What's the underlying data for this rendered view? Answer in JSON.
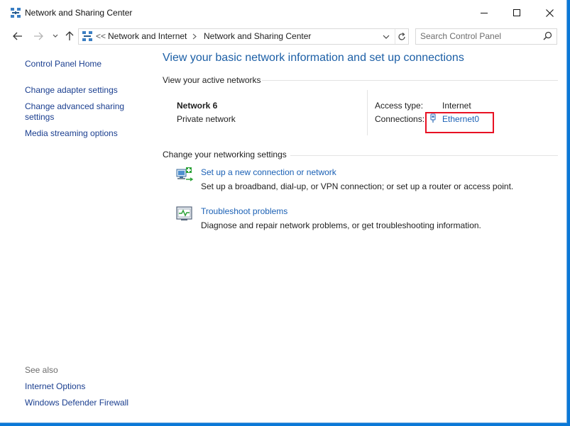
{
  "window": {
    "title": "Network and Sharing Center"
  },
  "navigation": {
    "breadcrumb": {
      "overflow": "<<",
      "items": [
        "Network and Internet",
        "Network and Sharing Center"
      ]
    },
    "search_placeholder": "Search Control Panel"
  },
  "left_pane": {
    "links": [
      "Control Panel Home",
      "Change adapter settings",
      "Change advanced sharing settings",
      "Media streaming options"
    ],
    "see_also_label": "See also",
    "see_also_links": [
      "Internet Options",
      "Windows Defender Firewall"
    ]
  },
  "main": {
    "heading": "View your basic network information and set up connections",
    "active_networks_title": "View your active networks",
    "network": {
      "name": "Network 6",
      "type": "Private network",
      "access_type_label": "Access type:",
      "access_type_value": "Internet",
      "connections_label": "Connections:",
      "connection_name": "Ethernet0"
    },
    "change_settings_title": "Change your networking settings",
    "tasks": [
      {
        "icon": "network-setup-icon",
        "title": "Set up a new connection or network",
        "description": "Set up a broadband, dial-up, or VPN connection; or set up a router or access point."
      },
      {
        "icon": "troubleshoot-icon",
        "title": "Troubleshoot problems",
        "description": "Diagnose and repair network problems, or get troubleshooting information."
      }
    ]
  },
  "colors": {
    "link": "#1a60b5",
    "heading": "#1c5fa6",
    "highlight": "#e81123",
    "desktop": "#0a78d7"
  }
}
